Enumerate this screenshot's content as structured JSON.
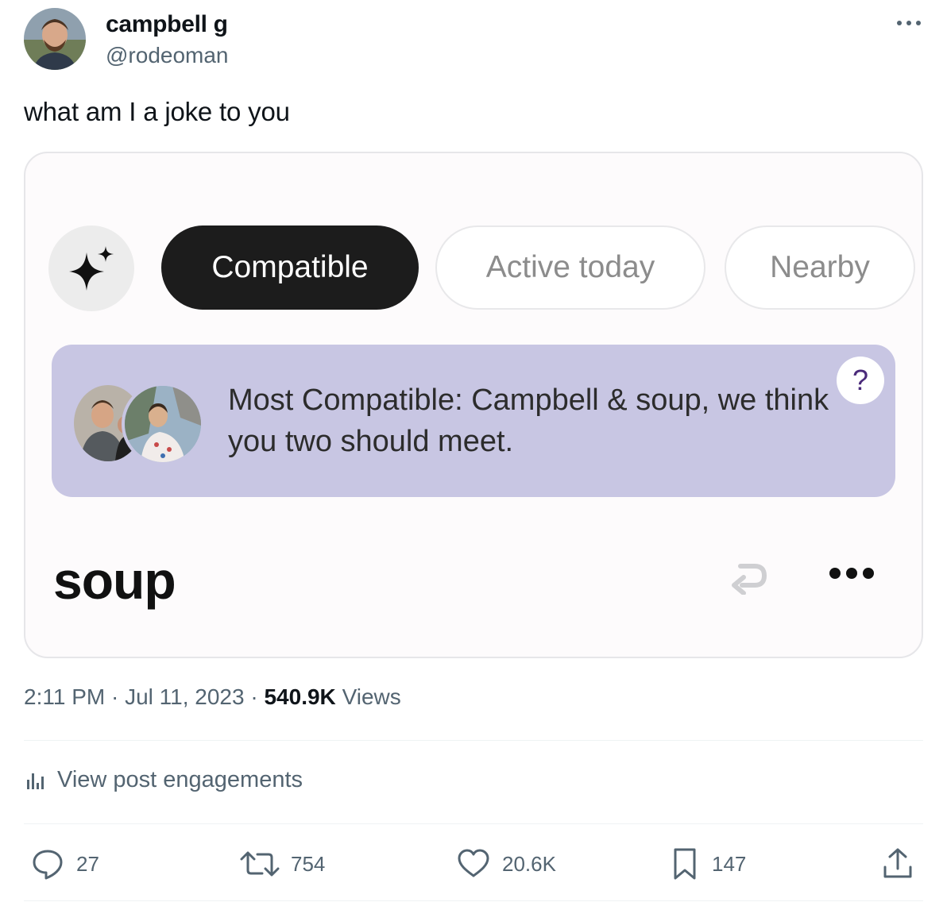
{
  "author": {
    "display_name": "campbell g",
    "handle": "@rodeoman"
  },
  "tweet": {
    "text": "what am I a joke to you"
  },
  "card": {
    "filters": [
      {
        "label": "Compatible",
        "active": true
      },
      {
        "label": "Active today",
        "active": false
      },
      {
        "label": "Nearby",
        "active": false
      }
    ],
    "banner_text": "Most Compatible: Campbell & soup, we think you two should meet.",
    "help_label": "?",
    "profile_name": "soup"
  },
  "meta": {
    "time": "2:11 PM",
    "date": "Jul 11, 2023",
    "views_count": "540.9K",
    "views_label": "Views"
  },
  "engagements_label": "View post engagements",
  "actions": {
    "replies": "27",
    "reposts": "754",
    "likes": "20.6K",
    "bookmarks": "147"
  },
  "colors": {
    "accent_pill": "#1c1c1c",
    "banner_bg": "#c8c6e3",
    "secondary_text": "#536471"
  },
  "icons": [
    "more-icon",
    "sparkle-icon",
    "help-icon",
    "undo-icon",
    "analytics-icon",
    "reply-icon",
    "repost-icon",
    "like-icon",
    "bookmark-icon",
    "share-icon"
  ]
}
